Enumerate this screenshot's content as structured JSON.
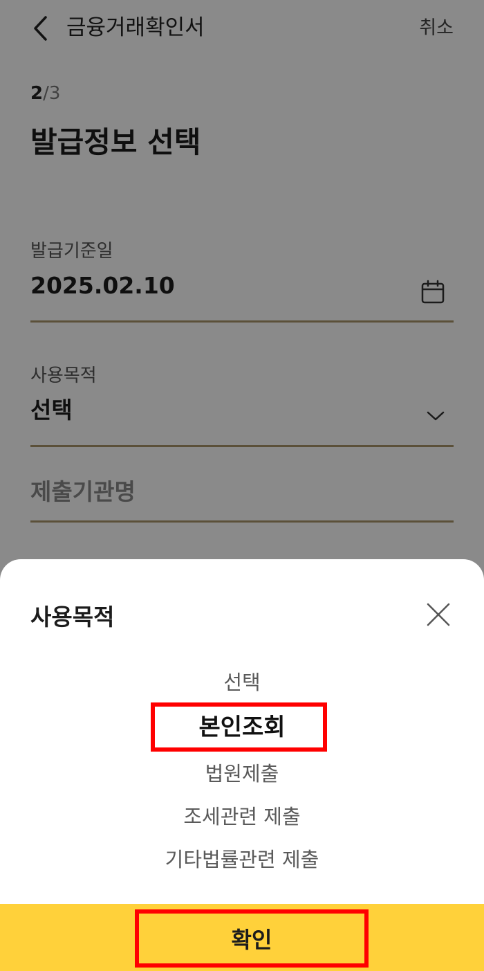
{
  "header": {
    "title": "금융거래확인서",
    "cancel_label": "취소"
  },
  "step": {
    "current": "2",
    "separator": "/",
    "total": "3"
  },
  "page_title": "발급정보 선택",
  "fields": {
    "issue_date": {
      "label": "발급기준일",
      "value": "2025.02.10"
    },
    "purpose": {
      "label": "사용목적",
      "value": "선택"
    },
    "institution": {
      "placeholder": "제출기관명"
    }
  },
  "sheet": {
    "title": "사용목적",
    "options": [
      "선택",
      "본인조회",
      "법원제출",
      "조세관련 제출",
      "기타법률관련 제출"
    ],
    "selected": "본인조회"
  },
  "confirm_label": "확인",
  "colors": {
    "accent_yellow": "#ffd13a",
    "underline": "#a8946a",
    "highlight_red": "#ff0000"
  }
}
